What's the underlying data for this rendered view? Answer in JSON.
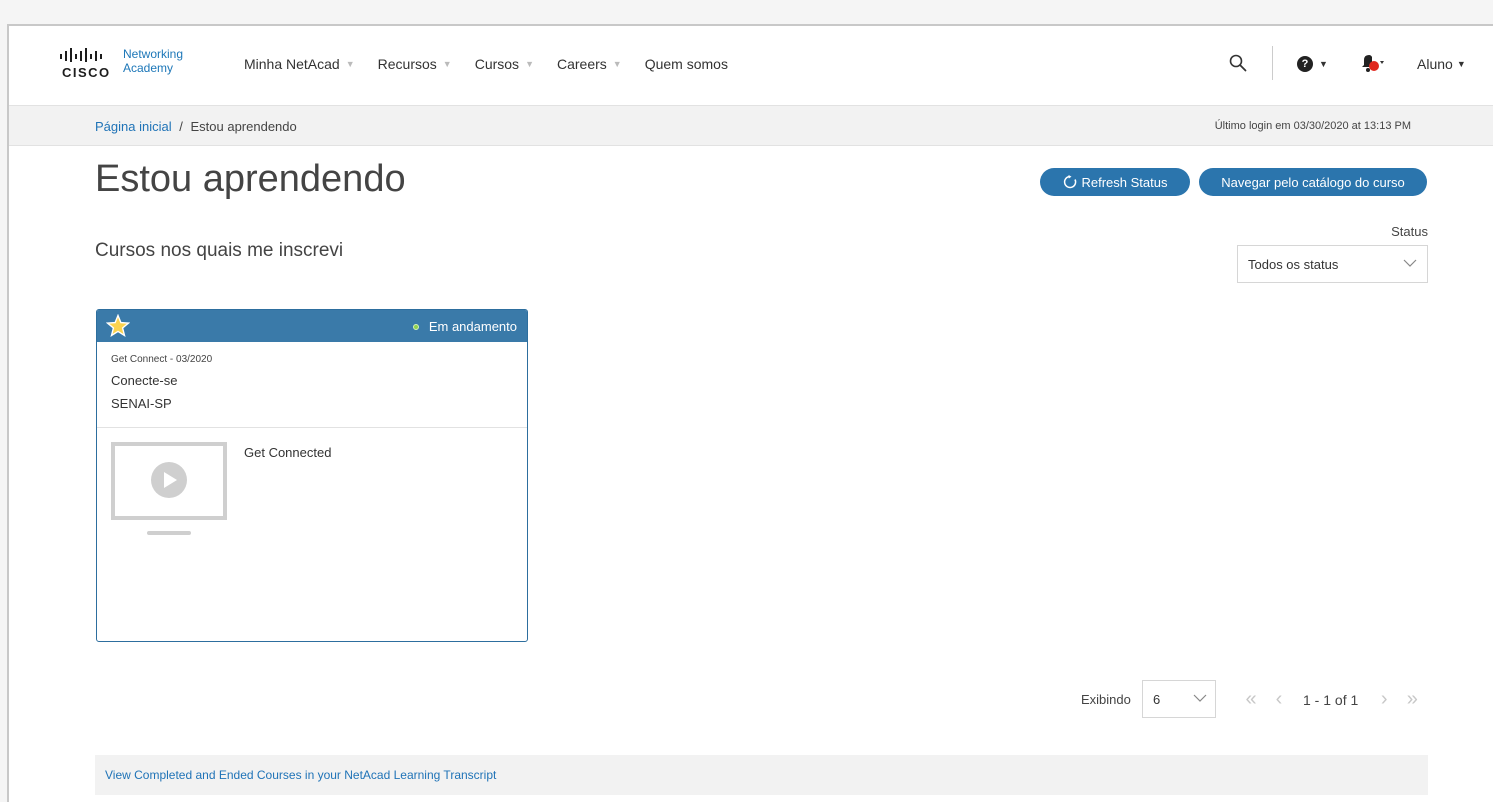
{
  "header": {
    "logo": {
      "brand": "CISCO",
      "line1": "Networking",
      "line2": "Academy"
    },
    "nav": [
      {
        "label": "Minha NetAcad",
        "has_caret": true
      },
      {
        "label": "Recursos",
        "has_caret": true
      },
      {
        "label": "Cursos",
        "has_caret": true
      },
      {
        "label": "Careers",
        "has_caret": true
      },
      {
        "label": "Quem somos",
        "has_caret": false
      }
    ],
    "help_symbol": "?",
    "user_label": "Aluno"
  },
  "breadcrumb": {
    "home": "Página inicial",
    "separator": "/",
    "current": "Estou aprendendo",
    "last_login": "Último login em 03/30/2020 at 13:13 PM"
  },
  "main": {
    "title": "Estou aprendendo",
    "refresh_label": "Refresh Status",
    "catalog_label": "Navegar pelo catálogo do curso",
    "subtitle": "Cursos nos quais me inscrevi",
    "status_label": "Status",
    "status_value": "Todos os status"
  },
  "course_card": {
    "status": "Em andamento",
    "code": "Get Connect - 03/2020",
    "name": "Conecte-se",
    "org": "SENAI-SP",
    "course": "Get Connected"
  },
  "pagination": {
    "showing_label": "Exibindo",
    "per_page": "6",
    "range": "1 - 1 of 1"
  },
  "footer": {
    "transcript_link": "View Completed and Ended Courses in your NetAcad Learning Transcript"
  },
  "colors": {
    "accent": "#2b75ad",
    "card_header": "#3a7aa9",
    "link": "#1f73b7",
    "status_dot": "#8fd14f",
    "notification": "#e0281e"
  },
  "icons": [
    "search-icon",
    "help-icon",
    "bell-icon",
    "star-icon",
    "refresh-icon",
    "chevron-down-icon",
    "video-thumbnail-icon"
  ]
}
